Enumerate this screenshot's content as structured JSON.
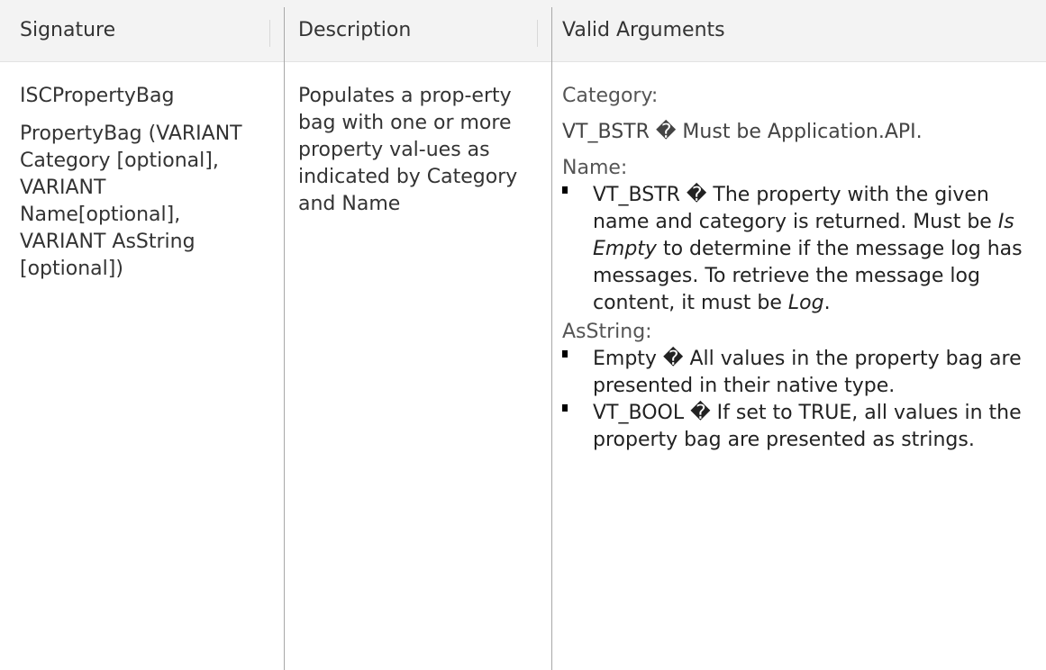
{
  "columns": {
    "signature": "Signature",
    "description": "Description",
    "valid_arguments": "Valid Arguments"
  },
  "signature_cell": {
    "name": "ISCPropertyBag",
    "definition": "PropertyBag (VARIANT Category [optional], VARIANT Name[optional], VARIANT AsString [optional])"
  },
  "description_cell": {
    "text": "Populates a prop-erty bag with one or more property val-ues as indicated by Category and Name"
  },
  "arguments_cell": {
    "category_label": "Category:",
    "category_value": "VT_BSTR � Must be Application.API.",
    "name_label": "Name:",
    "name_bullet_part1": "VT_BSTR � The property with the given name and category is returned. Must be ",
    "name_bullet_italic1": "Is Empty",
    "name_bullet_part2": " to determine if the message log has messages. To retrieve the message log content, it must be ",
    "name_bullet_italic2": "Log",
    "name_bullet_part3": ".",
    "asstring_label": "AsString:",
    "asstring_bullet1": "Empty � All values in the property bag are presented in their native type.",
    "asstring_bullet2": "VT_BOOL � If set to TRUE, all values in the property bag are presented as strings."
  }
}
